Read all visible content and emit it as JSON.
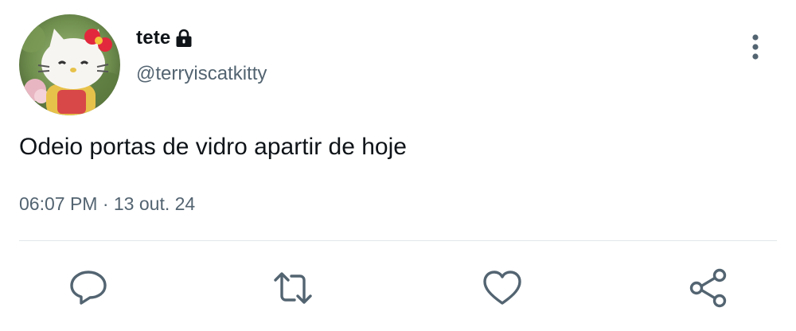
{
  "tweet": {
    "author": {
      "display_name": "tete",
      "handle": "@terryiscatkitty",
      "protected_icon": "lock-icon",
      "avatar": "hello-kitty-avatar"
    },
    "text": "Odeio portas de vidro apartir de hoje",
    "timestamp": "06:07 PM · 13 out. 24",
    "menu_icon": "more-vertical-icon"
  },
  "actions": [
    {
      "name": "reply",
      "icon": "reply-icon"
    },
    {
      "name": "retweet",
      "icon": "retweet-icon"
    },
    {
      "name": "like",
      "icon": "heart-icon"
    },
    {
      "name": "share",
      "icon": "share-icon"
    }
  ],
  "colors": {
    "primary_text": "#0f1419",
    "secondary_text": "#536471",
    "divider": "#e1e6ea",
    "background": "#ffffff"
  }
}
